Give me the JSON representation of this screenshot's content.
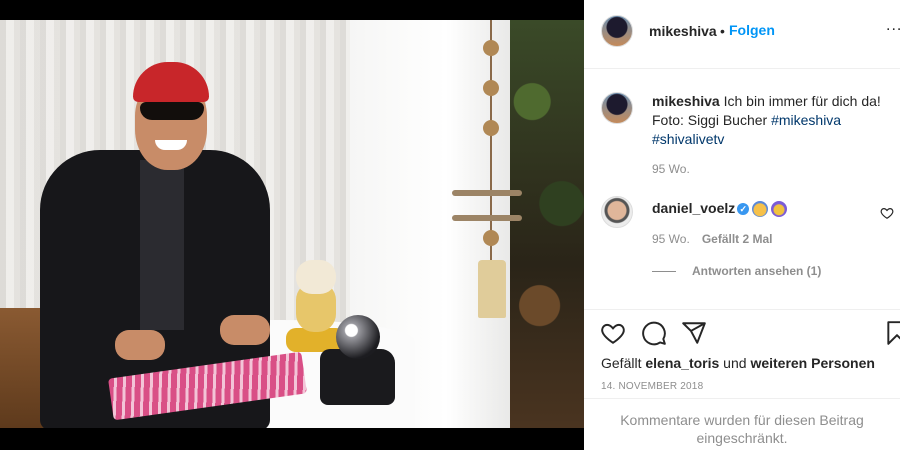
{
  "post": {
    "username": "mikeshiva",
    "separator": "•",
    "follow_label": "Folgen",
    "more_label": "...",
    "caption_user": "mikeshiva",
    "caption_text": " Ich bin immer für dich da! Foto: Siggi Bucher ",
    "caption_tag1": "#mikeshiva",
    "caption_tag2": "#shivalivetv",
    "caption_age": "95 Wo.",
    "photo_alt": "Mann mit rotem Kopftuch und Sonnenbrille am Tisch mit Tarotkarten, Winkekatze und Kristallkugel"
  },
  "comments": [
    {
      "username": "daniel_voelz",
      "age": "95 Wo.",
      "likes_label": "Gefällt 2 Mal",
      "replies_label": "Antworten ansehen (1)",
      "verified_mark": "✓"
    }
  ],
  "actions": {
    "likes_prefix": "Gefällt ",
    "likes_user": "elena_toris",
    "likes_mid": " und ",
    "likes_rest": "weiteren Personen",
    "date": "14. NOVEMBER 2018"
  },
  "footer": {
    "notice": "Kommentare wurden für diesen Beitrag eingeschränkt."
  },
  "colors": {
    "link_blue": "#0095f6",
    "hashtag": "#00376b",
    "muted": "#8e8e8e",
    "bandana": "#c8262a"
  },
  "icons": [
    "heart-icon",
    "comment-icon",
    "share-icon",
    "bookmark-icon",
    "verified-icon",
    "more-icon"
  ]
}
